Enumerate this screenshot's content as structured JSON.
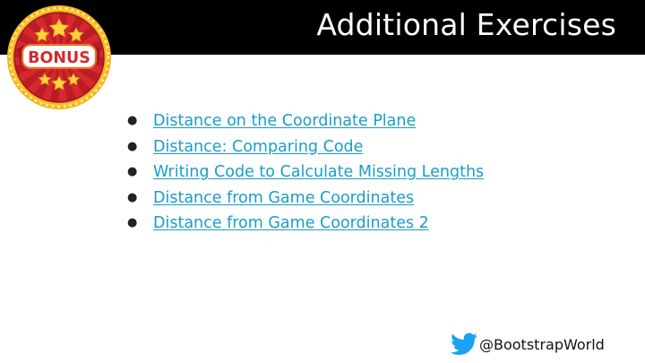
{
  "slide": {
    "title": "Additional Exercises",
    "badge": {
      "text": "BONUS",
      "icon": "bonus-badge-icon"
    },
    "exercises": [
      {
        "label": "Distance on the Coordinate Plane"
      },
      {
        "label": "Distance: Comparing Code"
      },
      {
        "label": "Writing Code to Calculate Missing Lengths"
      },
      {
        "label": "Distance from Game Coordinates"
      },
      {
        "label": "Distance from Game Coordinates 2"
      }
    ],
    "footer": {
      "handle": "@BootstrapWorld",
      "icon": "twitter-bird-icon"
    }
  },
  "colors": {
    "title_bar": "#000000",
    "title_text": "#ffffff",
    "link": "#1a9dc9",
    "twitter_blue": "#1da1f2",
    "badge_red": "#d6282e",
    "badge_gold": "#f7b519"
  }
}
